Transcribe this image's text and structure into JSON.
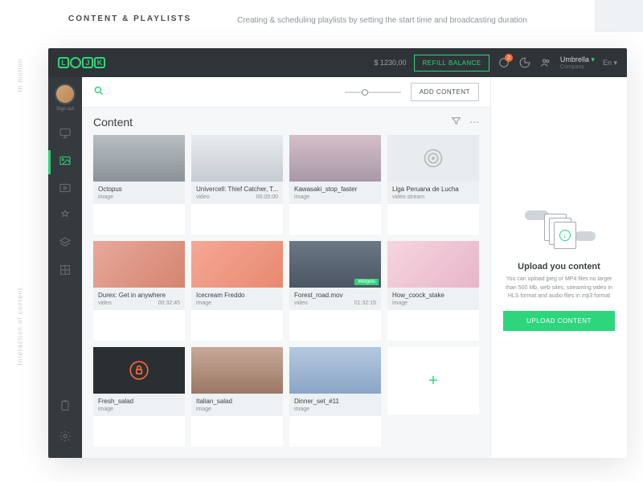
{
  "page": {
    "section_title": "CONTENT & PLAYLISTS",
    "section_desc": "Creating & scheduling playlists by setting the start time and broadcasting duration",
    "side_label_1": "In motion",
    "side_label_2": "Interaction of content"
  },
  "topbar": {
    "balance": "$ 1230,00",
    "refill_label": "REFILL BALANCE",
    "notification_count": "2",
    "company_name": "Umbrella",
    "company_label": "Company",
    "lang": "En"
  },
  "sidebar": {
    "signout_label": "Sign out"
  },
  "toolbar": {
    "add_content_label": "ADD CONTENT"
  },
  "content": {
    "title": "Content"
  },
  "cards": [
    {
      "title": "Octopus",
      "type": "image",
      "duration": "",
      "thumb": "t-bridge"
    },
    {
      "title": "Univercell: Thief Catcher, T...",
      "type": "video",
      "duration": "00:05:00",
      "thumb": "t-snow"
    },
    {
      "title": "Kawasaki_stop_faster",
      "type": "image",
      "duration": "",
      "thumb": "t-mountain"
    },
    {
      "title": "Liga Peruana de Lucha",
      "type": "video stream",
      "duration": "",
      "thumb": "t-grey",
      "icon": "target"
    },
    {
      "title": "Durex: Get in anywhere",
      "type": "video",
      "duration": "00:32:45",
      "thumb": "t-sneaker"
    },
    {
      "title": "Icecream Freddo",
      "type": "image",
      "duration": "",
      "thumb": "t-pingpong"
    },
    {
      "title": "Forest_road.mov",
      "type": "video",
      "duration": "01:32:15",
      "thumb": "t-forest",
      "widget": "Widgets"
    },
    {
      "title": "How_coock_stake",
      "type": "image",
      "duration": "",
      "thumb": "t-pink"
    },
    {
      "title": "Fresh_salad",
      "type": "image",
      "duration": "",
      "thumb": "t-dark",
      "icon": "lock"
    },
    {
      "title": "Italian_salad",
      "type": "image",
      "duration": "",
      "thumb": "t-rock"
    },
    {
      "title": "Dinner_set_#11",
      "type": "image",
      "duration": "",
      "thumb": "t-blue"
    }
  ],
  "upload": {
    "title": "Upload you content",
    "desc": "You can upload jpeg or MP4 files no larger than 500 Mb, web sites, streaming video in HLS format and audio files in mp3 format",
    "button_label": "UPLOAD CONTENT"
  }
}
